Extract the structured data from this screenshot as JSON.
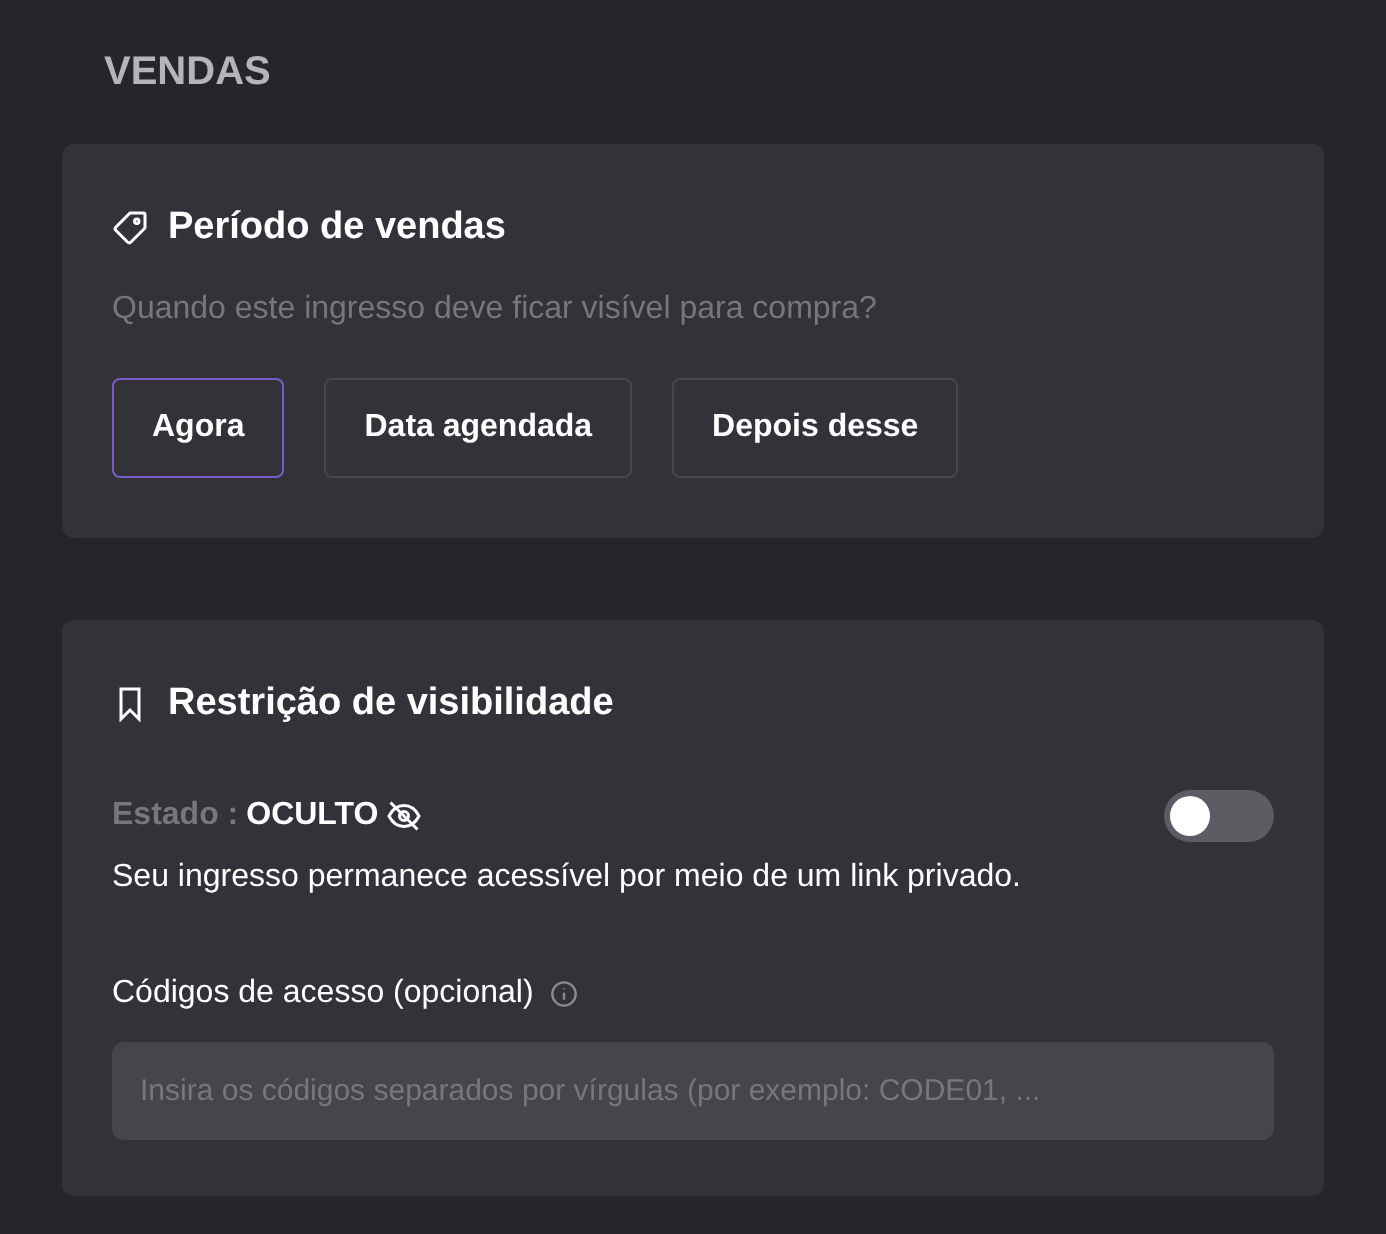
{
  "section_title": "VENDAS",
  "sales_period": {
    "title": "Período de vendas",
    "question": "Quando este ingresso deve ficar visível para compra?",
    "options": [
      {
        "label": "Agora",
        "selected": true
      },
      {
        "label": "Data agendada",
        "selected": false
      },
      {
        "label": "Depois desse",
        "selected": false
      }
    ]
  },
  "visibility": {
    "title": "Restrição de visibilidade",
    "status_label": "Estado :",
    "status_value": "OCULTO",
    "visible": false,
    "description": "Seu ingresso permanece acessível por meio de um link privado.",
    "access_codes": {
      "label": "Códigos de acesso (opcional)",
      "placeholder": "Insira os códigos separados por vírgulas (por exemplo: CODE01, ..."
    }
  }
}
